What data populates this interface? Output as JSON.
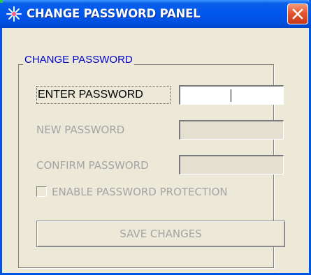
{
  "window": {
    "title": "CHANGE PASSWORD PANEL",
    "title_icon": "sparkle-icon",
    "close_icon": "close-icon",
    "accent_color": "#0058ee",
    "close_color": "#e4562f"
  },
  "group": {
    "title": "CHANGE PASSWORD"
  },
  "fields": {
    "enter_password": {
      "label": "ENTER PASSWORD",
      "value": "",
      "enabled": true
    },
    "new_password": {
      "label": "NEW PASSWORD",
      "value": "",
      "enabled": false
    },
    "confirm_password": {
      "label": "CONFIRM PASSWORD",
      "value": "",
      "enabled": false
    }
  },
  "protection": {
    "label": "ENABLE PASSWORD PROTECTION",
    "checked": false,
    "enabled": false
  },
  "actions": {
    "save_label": "SAVE CHANGES",
    "save_enabled": false
  }
}
